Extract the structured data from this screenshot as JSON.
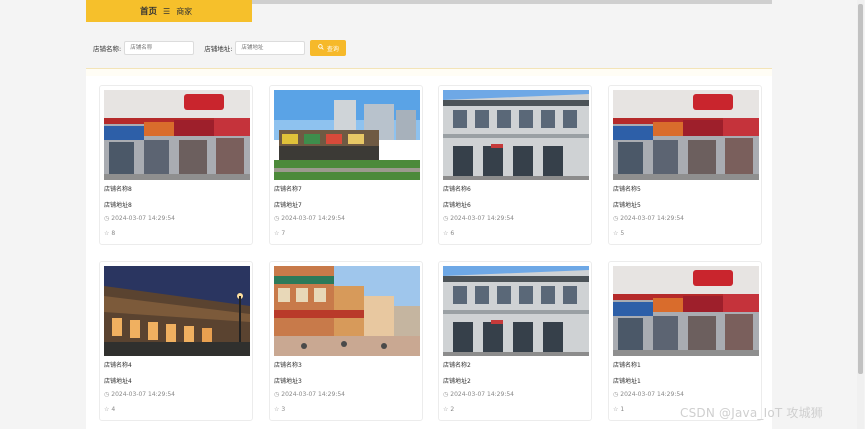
{
  "breadcrumb": {
    "home": "首页",
    "separator": "☰",
    "current": "商家"
  },
  "search": {
    "name_label": "店铺名称:",
    "name_placeholder": "店铺名称",
    "address_label": "店铺地址:",
    "address_placeholder": "店铺地址",
    "button_label": "查询"
  },
  "shops": [
    {
      "name": "店铺名称8",
      "address": "店铺地址8",
      "time": "2024-03-07 14:29:54",
      "likes": "8",
      "image": "storefront-red"
    },
    {
      "name": "店铺名称7",
      "address": "店铺地址7",
      "time": "2024-03-07 14:29:54",
      "likes": "7",
      "image": "mall-aerial"
    },
    {
      "name": "店铺名称6",
      "address": "店铺地址6",
      "time": "2024-03-07 14:29:54",
      "likes": "6",
      "image": "building-gray"
    },
    {
      "name": "店铺名称5",
      "address": "店铺地址5",
      "time": "2024-03-07 14:29:54",
      "likes": "5",
      "image": "storefront-red"
    },
    {
      "name": "店铺名称4",
      "address": "店铺地址4",
      "time": "2024-03-07 14:29:54",
      "likes": "4",
      "image": "street-night"
    },
    {
      "name": "店铺名称3",
      "address": "店铺地址3",
      "time": "2024-03-07 14:29:54",
      "likes": "3",
      "image": "commercial-street"
    },
    {
      "name": "店铺名称2",
      "address": "店铺地址2",
      "time": "2024-03-07 14:29:54",
      "likes": "2",
      "image": "building-gray"
    },
    {
      "name": "店铺名称1",
      "address": "店铺地址1",
      "time": "2024-03-07 14:29:54",
      "likes": "1",
      "image": "storefront-red"
    }
  ],
  "watermark": "CSDN @Java_IoT 攻城狮",
  "colors": {
    "accent": "#f6c02b",
    "button": "#f6b92a"
  }
}
